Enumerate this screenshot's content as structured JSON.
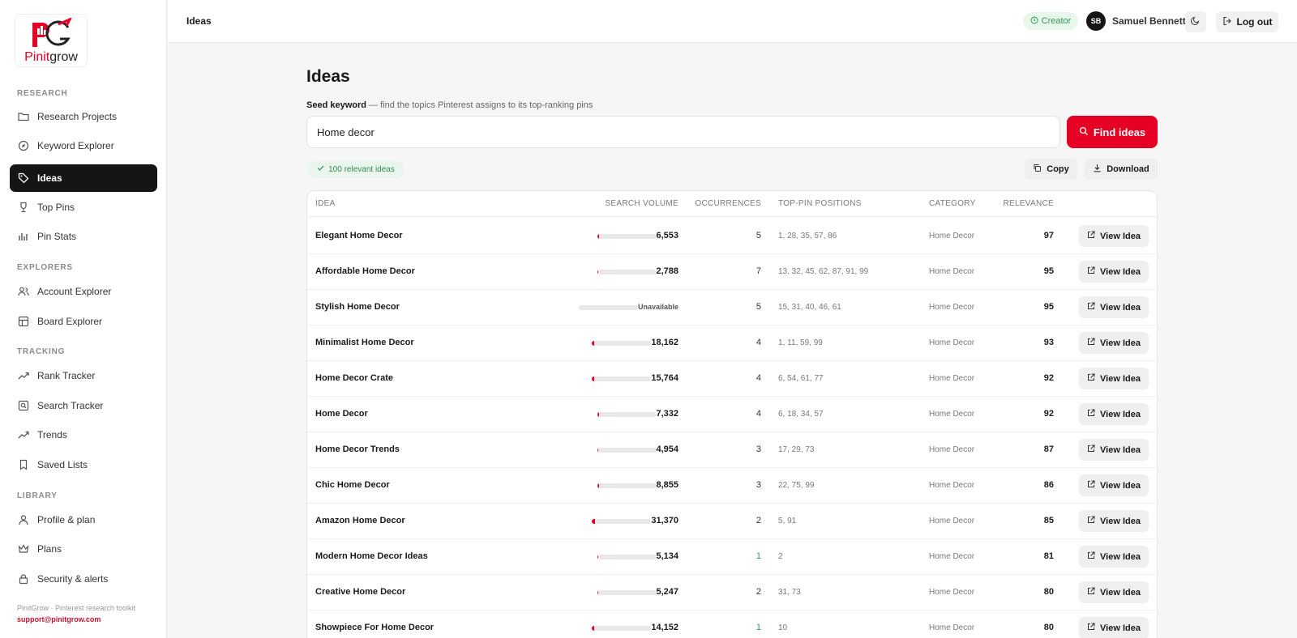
{
  "brand": {
    "name_p": "Pinit",
    "name_rest": "grow",
    "accent": "#e60023"
  },
  "sidebar": {
    "sections": {
      "research": "RESEARCH",
      "explorers": "EXPLORERS",
      "tracking": "TRACKING",
      "library": "LIBRARY"
    },
    "items": [
      {
        "label": "Research Projects",
        "icon": "folder-icon"
      },
      {
        "label": "Keyword Explorer",
        "icon": "compass-icon"
      },
      {
        "label": "Ideas",
        "icon": "tag-icon",
        "active": true
      },
      {
        "label": "Top Pins",
        "icon": "trophy-icon"
      },
      {
        "label": "Pin Stats",
        "icon": "bar-chart-icon"
      },
      {
        "label": "Account Explorer",
        "icon": "users-icon"
      },
      {
        "label": "Board Explorer",
        "icon": "board-icon"
      },
      {
        "label": "Rank Tracker",
        "icon": "trend-icon"
      },
      {
        "label": "Search Tracker",
        "icon": "search-box-icon"
      },
      {
        "label": "Trends",
        "icon": "trend-icon"
      },
      {
        "label": "Saved Lists",
        "icon": "bookmark-icon"
      },
      {
        "label": "Profile & plan",
        "icon": "user-icon"
      },
      {
        "label": "Plans",
        "icon": "crown-icon"
      },
      {
        "label": "Security & alerts",
        "icon": "lock-icon"
      }
    ],
    "footer": "PinitGrow · Pinterest research toolkit",
    "support_email": "support@pinitgrow.com"
  },
  "header": {
    "title": "Ideas",
    "plan_badge": "Creator",
    "avatar_initials": "SB",
    "user_name": "Samuel Bennett",
    "logout_label": "Log out"
  },
  "main": {
    "title": "Ideas",
    "seed_label": "Seed keyword",
    "seed_hint": "— find the topics Pinterest assigns to its top-ranking pins",
    "seed_value": "Home decor",
    "find_label": "Find ideas",
    "relevant_badge": "100 relevant ideas",
    "copy_label": "Copy",
    "download_label": "Download"
  },
  "table": {
    "headers": {
      "idea": "IDEA",
      "volume": "SEARCH VOLUME",
      "occurrences": "OCCURRENCES",
      "positions": "TOP-PIN POSITIONS",
      "category": "CATEGORY",
      "relevance": "RELEVANCE"
    },
    "view_label": "View Idea",
    "unavailable_label": "Unavailable",
    "rows": [
      {
        "idea": "Elegant Home Decor",
        "volume": "6,553",
        "vol_frac": 0.03,
        "occ": "5",
        "positions": "1, 28, 35, 57, 86",
        "category": "Home Decor",
        "relevance": "97"
      },
      {
        "idea": "Affordable Home Decor",
        "volume": "2,788",
        "vol_frac": 0.02,
        "occ": "7",
        "positions": "13, 32, 45, 62, 87, 91, 99",
        "category": "Home Decor",
        "relevance": "95"
      },
      {
        "idea": "Stylish Home Decor",
        "volume": "Unavailable",
        "vol_frac": 0,
        "occ": "5",
        "positions": "15, 31, 40, 46, 61",
        "category": "Home Decor",
        "relevance": "95"
      },
      {
        "idea": "Minimalist Home Decor",
        "volume": "18,162",
        "vol_frac": 0.04,
        "occ": "4",
        "positions": "1, 11, 59, 99",
        "category": "Home Decor",
        "relevance": "93"
      },
      {
        "idea": "Home Decor Crate",
        "volume": "15,764",
        "vol_frac": 0.04,
        "occ": "4",
        "positions": "6, 54, 61, 77",
        "category": "Home Decor",
        "relevance": "92"
      },
      {
        "idea": "Home Decor",
        "volume": "7,332",
        "vol_frac": 0.03,
        "occ": "4",
        "positions": "6, 18, 34, 57",
        "category": "Home Decor",
        "relevance": "92"
      },
      {
        "idea": "Home Decor Trends",
        "volume": "4,954",
        "vol_frac": 0.02,
        "occ": "3",
        "positions": "17, 29, 73",
        "category": "Home Decor",
        "relevance": "87"
      },
      {
        "idea": "Chic Home Decor",
        "volume": "8,855",
        "vol_frac": 0.03,
        "occ": "3",
        "positions": "22, 75, 99",
        "category": "Home Decor",
        "relevance": "86"
      },
      {
        "idea": "Amazon Home Decor",
        "volume": "31,370",
        "vol_frac": 0.05,
        "occ": "2",
        "positions": "5, 91",
        "category": "Home Decor",
        "relevance": "85"
      },
      {
        "idea": "Modern Home Decor Ideas",
        "volume": "5,134",
        "vol_frac": 0.02,
        "occ": "1",
        "positions": "2",
        "category": "Home Decor",
        "relevance": "81",
        "occ_low": true
      },
      {
        "idea": "Creative Home Decor",
        "volume": "5,247",
        "vol_frac": 0.02,
        "occ": "2",
        "positions": "31, 73",
        "category": "Home Decor",
        "relevance": "80"
      },
      {
        "idea": "Showpiece For Home Decor",
        "volume": "14,152",
        "vol_frac": 0.04,
        "occ": "1",
        "positions": "10",
        "category": "Home Decor",
        "relevance": "80",
        "occ_low": true
      }
    ]
  }
}
